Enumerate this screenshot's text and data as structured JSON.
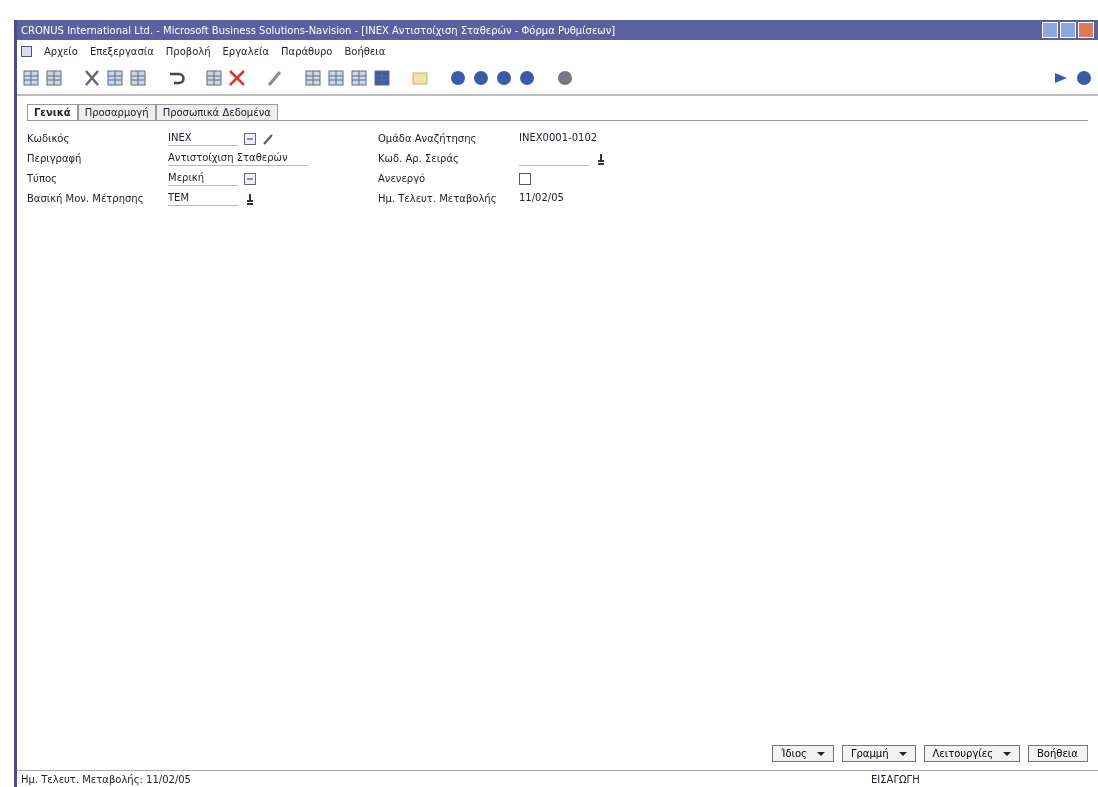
{
  "window": {
    "title": "CRONUS International Ltd. - Microsoft Business Solutions-Navision - [INEX Αντιστοίχιση Σταθερών - Φόρμα Ρυθμίσεων]"
  },
  "menu": [
    "Αρχείο",
    "Επεξεργασία",
    "Προβολή",
    "Εργαλεία",
    "Παράθυρο",
    "Βοήθεια"
  ],
  "tabs": [
    {
      "label": "Γενικά",
      "selected": true
    },
    {
      "label": "Προσαρμογή",
      "selected": false
    },
    {
      "label": "Προσωπικά Δεδομένα",
      "selected": false
    }
  ],
  "left_fields": [
    {
      "label": "Κωδικός",
      "value": "INEX",
      "kind": "lookup"
    },
    {
      "label": "Περιγραφή",
      "value": "Αντιστοίχιση Σταθερών",
      "kind": "text"
    },
    {
      "label": "Τύπος",
      "value": "Μερική",
      "kind": "option"
    },
    {
      "label": "Βασική Μον. Μέτρησης",
      "value": "ΤΕΜ",
      "kind": "select"
    }
  ],
  "right_fields": [
    {
      "label": "Ομάδα Αναζήτησης",
      "value": "INEX0001-0102",
      "kind": "plain"
    },
    {
      "label": "Κωδ. Αρ. Σειράς",
      "kind": "select"
    },
    {
      "label": "Ανενεργό",
      "checked": false,
      "kind": "checkbox"
    },
    {
      "label": "Ημ. Τελευτ. Μεταβολής",
      "value": "11/02/05",
      "kind": "plain"
    }
  ],
  "buttons": [
    {
      "label": "Ίδιος",
      "dropdown": true
    },
    {
      "label": "Γραμμή",
      "dropdown": true
    },
    {
      "label": "Λειτουργίες",
      "dropdown": true
    },
    {
      "label": "Βοήθεια",
      "dropdown": false
    }
  ],
  "status_bar": {
    "left": "Ημ. Τελευτ. Μεταβολής: 11/02/05",
    "middle": "ΕΙΣΑΓΩΓΗ"
  }
}
